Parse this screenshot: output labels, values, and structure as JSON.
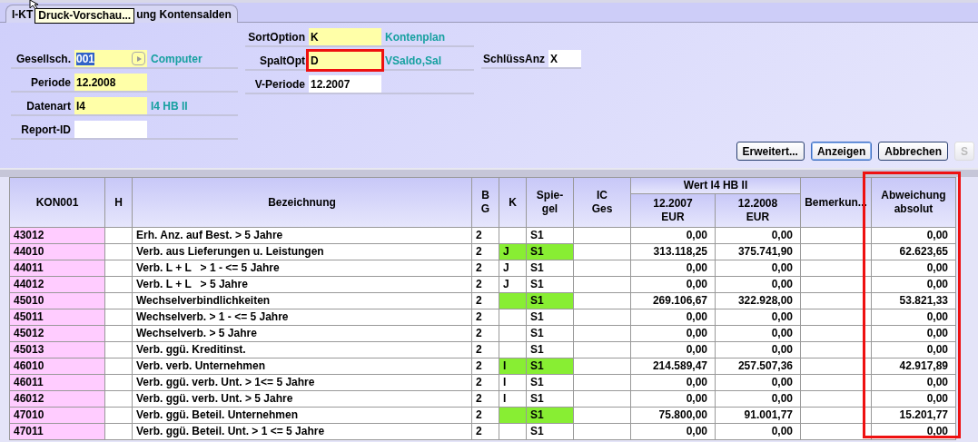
{
  "tab": {
    "label_start": "I-KT",
    "label_end": "ung Kontensalden"
  },
  "tooltip": "Druck-Vorschau...",
  "form_columns": [
    {
      "fields": [
        {
          "label": "Gesellsch.",
          "value": "001",
          "required": true,
          "value_selected": true,
          "lookup": true,
          "description": "Computer",
          "marked": false
        },
        {
          "label": "Periode",
          "value": "12.2008",
          "required": true,
          "value_selected": false,
          "lookup": false,
          "marked": false
        },
        {
          "label": "Datenart",
          "value": "I4",
          "required": true,
          "value_selected": false,
          "lookup": false,
          "description": "I4 HB II",
          "marked": false
        },
        {
          "label": "Report-ID",
          "required": false,
          "lookup": false,
          "marked": false
        }
      ]
    },
    {
      "fields": [
        {
          "label": "SortOption",
          "value": "K",
          "required": true,
          "value_selected": false,
          "lookup": false,
          "description": "Kontenplan",
          "marked": false
        },
        {
          "label": "SpaltOpt",
          "value": "D",
          "required": true,
          "value_selected": false,
          "lookup": false,
          "description": "VSaldo,Sal",
          "marked": true
        },
        {
          "label": "V-Periode",
          "value": "12.2007",
          "required": false,
          "value_selected": false,
          "lookup": false,
          "marked": false
        }
      ]
    },
    {
      "fields": [
        {
          "label": "SchlüssAnz",
          "value": "X",
          "required": false,
          "value_selected": false,
          "lookup": false,
          "marked": false
        }
      ]
    }
  ],
  "buttons": [
    {
      "label": "Erweitert...",
      "disabled": false,
      "selected": false
    },
    {
      "label": "Anzeigen",
      "disabled": false,
      "selected": true
    },
    {
      "label": "Abbrechen",
      "disabled": false,
      "selected": false
    },
    {
      "label": "S",
      "disabled": true,
      "selected": false
    }
  ],
  "table": {
    "columns": [
      {
        "lines": [
          "KON001"
        ],
        "marked": false
      },
      {
        "lines": [
          "H"
        ],
        "marked": false
      },
      {
        "lines": [
          "Bezeichnung"
        ],
        "marked": false
      },
      {
        "lines": [
          "B",
          "G"
        ],
        "marked": false
      },
      {
        "lines": [
          "K"
        ],
        "marked": false
      },
      {
        "lines": [
          "Spie-",
          "gel"
        ],
        "marked": false
      },
      {
        "lines": [
          "IC",
          "Ges"
        ],
        "marked": false
      },
      {
        "group": "Wert I4 HB II",
        "subcolumns": [
          {
            "lines": [
              "12.2007",
              "EUR"
            ],
            "marked": false
          },
          {
            "lines": [
              "12.2008",
              "EUR"
            ],
            "marked": false
          }
        ]
      },
      {
        "lines": [
          "Bemerkun..."
        ],
        "marked": false
      },
      {
        "lines": [
          "Abweichung",
          "absolut"
        ],
        "marked": true
      }
    ],
    "rows": [
      {
        "cells": [
          "43012",
          "",
          "Erh. Anz. auf Best. > 5 Jahre",
          "2",
          "",
          "S1",
          "",
          "0,00",
          "0,00",
          "",
          "0,00"
        ],
        "highlighted": false
      },
      {
        "cells": [
          "44010",
          "",
          "Verb. aus Lieferungen u. Leistungen",
          "2",
          "J",
          "S1",
          "",
          "313.118,25",
          "375.741,90",
          "",
          "62.623,65"
        ],
        "highlighted": true
      },
      {
        "cells": [
          "44011",
          "",
          "Verb. L + L   > 1 - <= 5 Jahre",
          "2",
          "J",
          "S1",
          "",
          "0,00",
          "0,00",
          "",
          "0,00"
        ],
        "highlighted": false
      },
      {
        "cells": [
          "44012",
          "",
          "Verb. L + L   > 5 Jahre",
          "2",
          "J",
          "S1",
          "",
          "0,00",
          "0,00",
          "",
          "0,00"
        ],
        "highlighted": false
      },
      {
        "cells": [
          "45010",
          "",
          "Wechselverbindlichkeiten",
          "2",
          "",
          "S1",
          "",
          "269.106,67",
          "322.928,00",
          "",
          "53.821,33"
        ],
        "highlighted": true
      },
      {
        "cells": [
          "45011",
          "",
          "Wechselverb. > 1 - <= 5 Jahre",
          "2",
          "",
          "S1",
          "",
          "0,00",
          "0,00",
          "",
          "0,00"
        ],
        "highlighted": false
      },
      {
        "cells": [
          "45012",
          "",
          "Wechselverb. > 5 Jahre",
          "2",
          "",
          "S1",
          "",
          "0,00",
          "0,00",
          "",
          "0,00"
        ],
        "highlighted": false
      },
      {
        "cells": [
          "45013",
          "",
          "Verb. ggü. Kreditinst.",
          "2",
          "",
          "S1",
          "",
          "0,00",
          "0,00",
          "",
          "0,00"
        ],
        "highlighted": false
      },
      {
        "cells": [
          "46010",
          "",
          "Verb. verb. Unternehmen",
          "2",
          "I",
          "S1",
          "",
          "214.589,47",
          "257.507,36",
          "",
          "42.917,89"
        ],
        "highlighted": true
      },
      {
        "cells": [
          "46011",
          "",
          "Verb. ggü. verb. Unt. > 1<= 5 Jahre",
          "2",
          "I",
          "S1",
          "",
          "0,00",
          "0,00",
          "",
          "0,00"
        ],
        "highlighted": false
      },
      {
        "cells": [
          "46012",
          "",
          "Verb. ggü. verb. Unt. > 5 Jahre",
          "2",
          "I",
          "S1",
          "",
          "0,00",
          "0,00",
          "",
          "0,00"
        ],
        "highlighted": false
      },
      {
        "cells": [
          "47010",
          "",
          "Verb. ggü. Beteil. Unternehmen",
          "2",
          "",
          "S1",
          "",
          "75.800,00",
          "91.001,77",
          "",
          "15.201,77"
        ],
        "highlighted": true
      },
      {
        "cells": [
          "47011",
          "",
          "Verb. ggü. Beteil. Unt. > 1 <= 5 Jahre",
          "2",
          "",
          "S1",
          "",
          "0,00",
          "0,00",
          "",
          "0,00"
        ],
        "highlighted": false
      }
    ]
  }
}
